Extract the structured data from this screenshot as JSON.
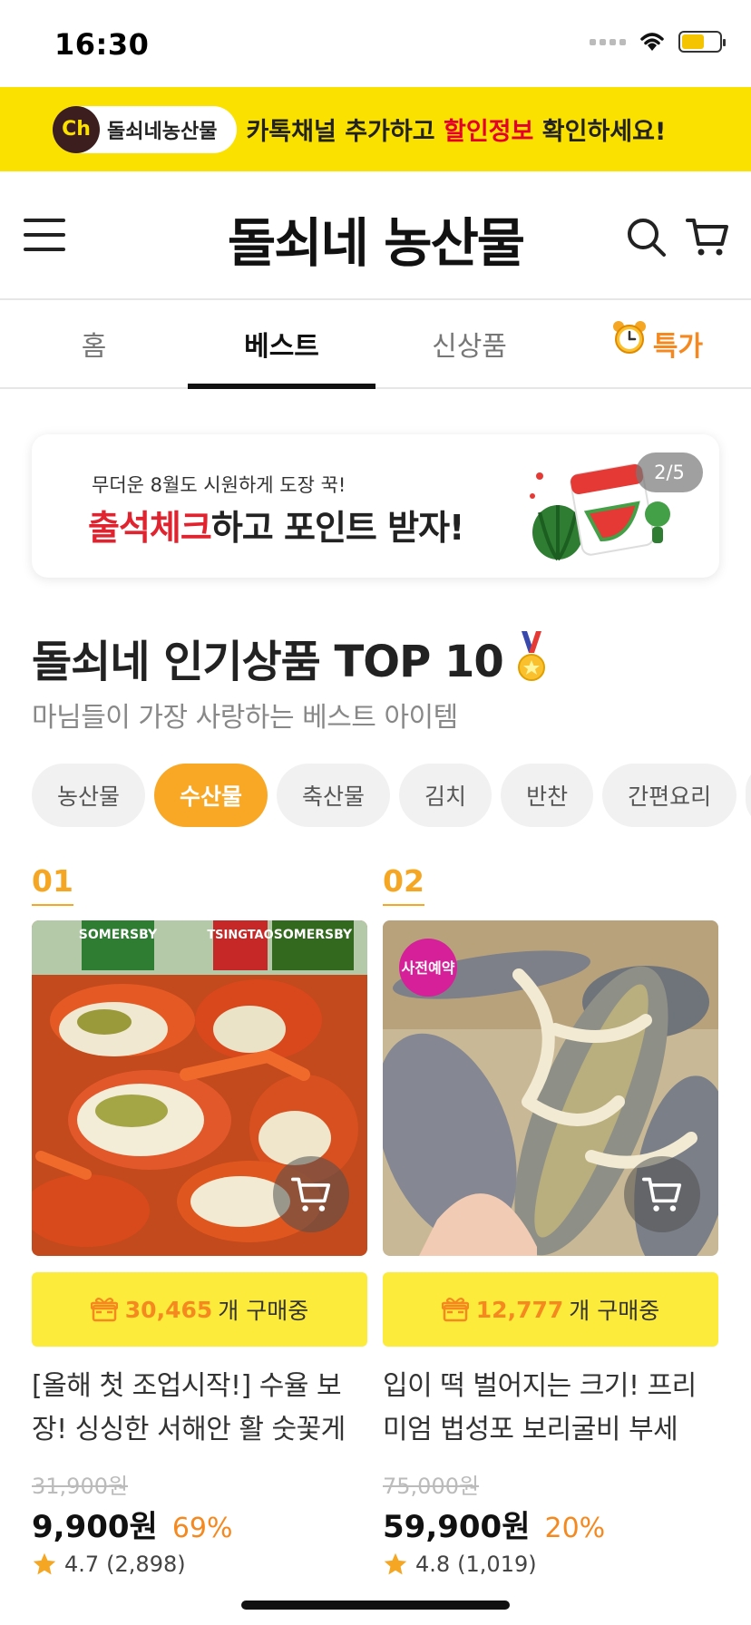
{
  "status_bar": {
    "time": "16:30"
  },
  "kakao_banner": {
    "channel_badge": "Ch",
    "channel_name": "돌쇠네농산물",
    "msg_before": "카톡채널 추가하고 ",
    "msg_highlight": "할인정보",
    "msg_after": " 확인하세요!"
  },
  "header": {
    "logo": "돌쇠네 농산물"
  },
  "tabs": [
    {
      "label": "홈"
    },
    {
      "label": "베스트"
    },
    {
      "label": "신상품"
    },
    {
      "label": "특가"
    }
  ],
  "promo": {
    "subtitle": "무더운 8월도 시원하게 도장 꾹!",
    "title_red": "출석체크",
    "title_rest": "하고 포인트 받자!",
    "counter": "2/5"
  },
  "section": {
    "title": "돌쇠네 인기상품 TOP 10",
    "subtitle": "마님들이 가장 사랑하는 베스트 아이템"
  },
  "chips": [
    {
      "label": "농산물"
    },
    {
      "label": "수산물"
    },
    {
      "label": "축산물"
    },
    {
      "label": "김치"
    },
    {
      "label": "반찬"
    },
    {
      "label": "간편요리"
    }
  ],
  "products": [
    {
      "rank": "01",
      "buying_count": "30,465",
      "buying_suffix": "개 구매중",
      "name": "[올해 첫 조업시작!] 수율 보장! 싱싱한 서해안 활 숫꽃게",
      "original_price": "31,900원",
      "price": "9,900원",
      "discount": "69%",
      "rating": "4.7",
      "reviews": "(2,898)",
      "image_labels": [
        "SOMERSBY",
        "TSINGTAO",
        "SOMERSBY"
      ]
    },
    {
      "rank": "02",
      "badge": "사전예약",
      "buying_count": "12,777",
      "buying_suffix": "개 구매중",
      "name": "입이 떡 벌어지는 크기! 프리미엄 법성포 보리굴비 부세",
      "original_price": "75,000원",
      "price": "59,900원",
      "discount": "20%",
      "rating": "4.8",
      "reviews": "(1,019)"
    }
  ],
  "colors": {
    "kakao_yellow": "#fae100",
    "accent_orange": "#f5891f",
    "chip_active": "#f9a825",
    "buying_bg": "#fdeb3c"
  }
}
